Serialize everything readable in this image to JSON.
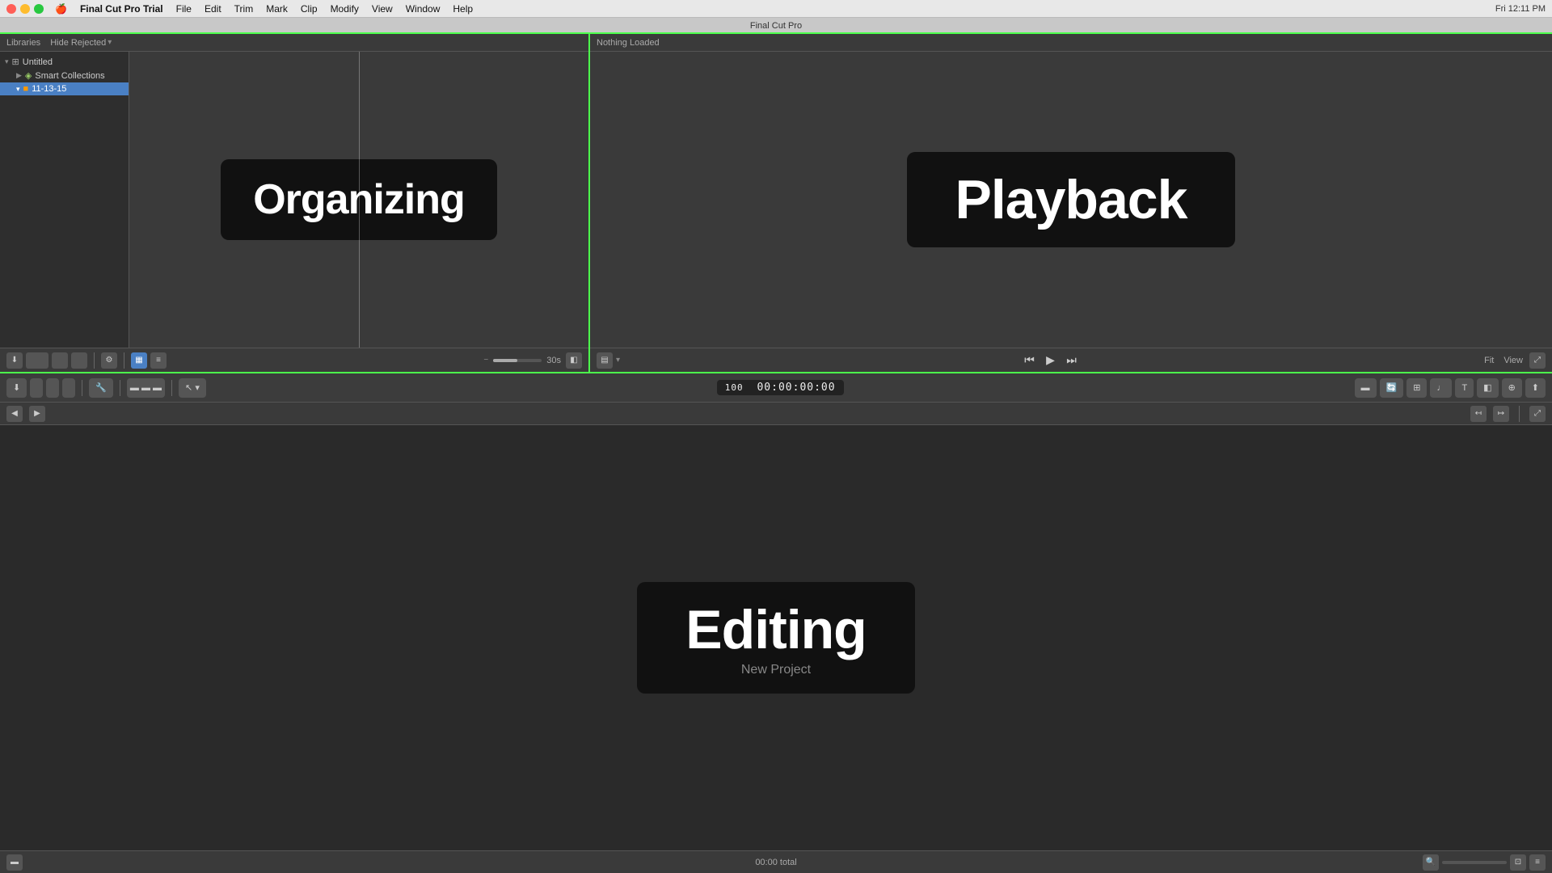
{
  "app": {
    "title": "Final Cut Pro",
    "full_title": "Final Cut Pro Trial",
    "window_title": "Final Cut Pro"
  },
  "menubar": {
    "apple": "🍎",
    "items": [
      "Final Cut Pro Trial",
      "File",
      "Edit",
      "Trim",
      "Mark",
      "Clip",
      "Modify",
      "View",
      "Window",
      "Help"
    ],
    "right_info": "Fri 12:11 PM"
  },
  "browser": {
    "header_label": "Libraries",
    "filter_label": "Hide Rejected",
    "sidebar": {
      "items": [
        {
          "label": "Untitled",
          "icon": "grid",
          "level": 0,
          "expanded": true
        },
        {
          "label": "Smart Collections",
          "icon": "folder",
          "level": 1,
          "expanded": false
        },
        {
          "label": "11-13-15",
          "icon": "film",
          "level": 1,
          "expanded": false,
          "selected": true
        }
      ]
    },
    "media_content": "Organizing",
    "footer": {
      "duration": "30s"
    }
  },
  "viewer": {
    "header_label": "Nothing Loaded",
    "content": "Playback",
    "footer": {
      "fit_label": "Fit",
      "view_label": "View"
    }
  },
  "toolbar": {
    "timecode": "00:00:00:00",
    "zoom_level": "100"
  },
  "timeline": {
    "header": {
      "total_label": "00:00 total"
    },
    "content": {
      "main_text": "Editing",
      "subtitle": "New Project"
    }
  },
  "icons": {
    "apple": "⌘",
    "play_back": "⏮",
    "play": "▶",
    "play_forward": "⏭",
    "arrow_left": "◀",
    "arrow_right": "▶",
    "down_arrow": "▾",
    "grid_icon": "⊞",
    "gear_icon": "⚙",
    "list_icon": "≡",
    "clip_icon": "▬"
  }
}
